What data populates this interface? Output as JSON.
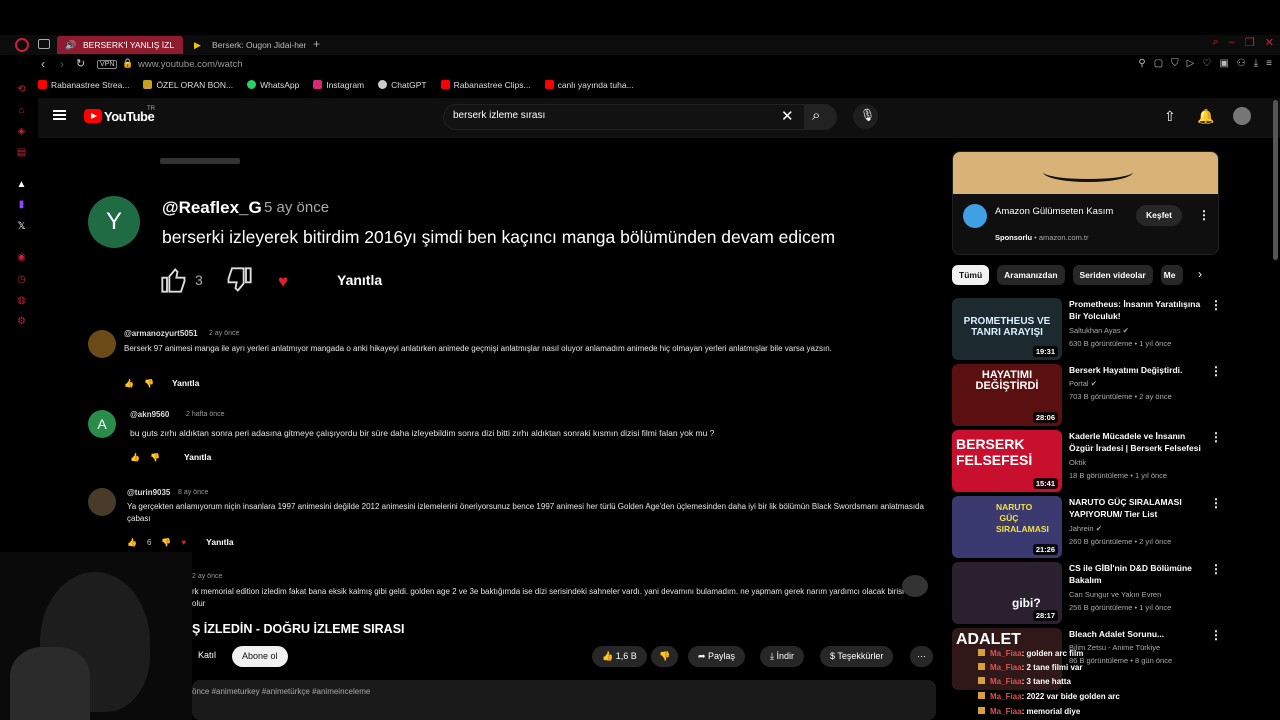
{
  "browser": {
    "tabs": [
      {
        "label": "BERSERK'İ YANLIŞ İZL",
        "active": true
      },
      {
        "label": "Berserk: Ougon Jidai-hen",
        "active": false
      }
    ],
    "url": "www.youtube.com/watch",
    "vpn": "VPN",
    "bookmarks": [
      {
        "label": "Rabanastree Strea...",
        "color": "#ff0000"
      },
      {
        "label": "ÖZEL ORAN BON...",
        "color": "#c8a020"
      },
      {
        "label": "WhatsApp",
        "color": "#25d366"
      },
      {
        "label": "Instagram",
        "color": "#d62976"
      },
      {
        "label": "ChatGPT",
        "color": "#cccccc"
      },
      {
        "label": "Rabanastree Clips...",
        "color": "#ff0000"
      },
      {
        "label": "canlı yayında tuha...",
        "color": "#ff0000"
      }
    ]
  },
  "youtube": {
    "logo": "YouTube",
    "region": "TR",
    "search_query": "berserk izleme sırası"
  },
  "featured_comment": {
    "avatar_letter": "Y",
    "author": "@Reaflex_G",
    "time": "5 ay önce",
    "text": "berserki izleyerek bitirdim 2016yı şimdi ben kaçıncı manga bölümünden devam edicem",
    "likes": "3",
    "reply": "Yanıtla"
  },
  "comments": [
    {
      "author": "@armanozyurt5051",
      "time": "2 ay önce",
      "text": "Berserk 97 animesi manga ile ayrı yerleri anlatmıyor mangada o anki hikayeyi anlatırken animede geçmişi anlatmışlar nasıl oluyor anlamadım animede hiç olmayan yerleri anlatmışlar bile varsa yazsın.",
      "likes": "",
      "reply": "Yanıtla"
    },
    {
      "author": "@akn9560",
      "time": "2 hafta önce",
      "text": "bu guts zırhı aldıktan sonra peri adasına gitmeye çalışıyordu bir süre daha izleyebildim sonra dizi bitti zırhı aldıktan sonraki kısmın dizisi filmi falan yok mu ?",
      "avatar_letter": "A",
      "likes": "",
      "reply": "Yanıtla"
    },
    {
      "author": "@turin9035",
      "time": "8 ay önce",
      "text": "Ya gerçekten anlamıyorum niçin insanlara 1997 animesini değilde 2012 animesini izlemelerini öneriyorsunuz bence 1997 animesi her türlü Golden Age'den üçlemesinden daha iyi bir lik bölümün Black Swordsmanı anlatmasıda çabası",
      "likes": "6",
      "reply": "Yanıtla"
    },
    {
      "author": "",
      "time": "2 ay önce",
      "text": "rk memorial edition izledim fakat bana eksik kalmış gibi geldi. golden age 2 ve 3e baktığımda ise dizi serisindeki sahneler vardı. yani devamını bulamadım. ne yapmam gerek narım yardımcı olacak birisi olur",
      "likes": "",
      "reply": ""
    }
  ],
  "video": {
    "title": "Ş İZLEDİN - DOĞRU İZLEME SIRASI",
    "join": "Katıl",
    "subscribe": "Abone ol",
    "likes": "1,6 B",
    "share": "Paylaş",
    "download": "İndir",
    "thanks": "Teşekkürler",
    "description": "önce #animeturkey #animetürkçe #animeinceleme"
  },
  "ad": {
    "title": "Amazon Gülümseten Kasım",
    "sponsor_label": "Sponsorlu",
    "domain": "amazon.com.tr",
    "button": "Keşfet"
  },
  "chips": [
    "Tümü",
    "Aramanızdan",
    "Seriden videolar",
    "Me"
  ],
  "recommendations": [
    {
      "title": "Prometheus: İnsanın Yaratılışına Bir Yolculuk!",
      "channel": "Saltukhan Ayas",
      "meta": "630 B görüntüleme • 1 yıl önce",
      "duration": "19:31",
      "thumb_text": "PROMETHEUS VE TANRI ARAYIŞI",
      "thumb_color": "#1c2a30",
      "thumb_fg": "#d9f0ff"
    },
    {
      "title": "Berserk Hayatımı Değiştirdi.",
      "channel": "Portal",
      "meta": "703 B görüntüleme • 2 ay önce",
      "duration": "28:06",
      "thumb_text": "HAYATIMI DEĞİŞTİRDİ",
      "thumb_color": "#5a1010",
      "thumb_fg": "#ffffff"
    },
    {
      "title": "Kaderle Mücadele ve İnsanın Özgür İradesi | Berserk Felsefesi",
      "channel": "Oktik",
      "meta": "18 B görüntüleme • 1 yıl önce",
      "duration": "15:41",
      "thumb_text": "BERSERK FELSEFESİ",
      "thumb_color": "#c8102e",
      "thumb_fg": "#ffffff"
    },
    {
      "title": "NARUTO GÜÇ SIRALAMASI YAPIYORUM/ Tier List",
      "channel": "Jahrein",
      "meta": "260 B görüntüleme • 2 yıl önce",
      "duration": "21:26",
      "thumb_text": "NARUTO GÜÇ SIRALAMASI",
      "thumb_color": "#3a3a70",
      "thumb_fg": "#f5e040"
    },
    {
      "title": "CS ile GİBİ'nin D&D Bölümüne Bakalım",
      "channel": "Can Sungur ve Yakın Evren",
      "meta": "256 B görüntüleme • 1 yıl önce",
      "duration": "28:17",
      "thumb_text": "gibi?",
      "thumb_color": "#2a2030",
      "thumb_fg": "#ffffff"
    },
    {
      "title": "Bleach Adalet Sorunu...",
      "channel": "Bilim Zetsu - Anime Türkiye",
      "meta": "86 B görüntüleme • 8 gün önce",
      "duration": "",
      "thumb_text": "ADALET",
      "thumb_color": "#301818",
      "thumb_fg": "#ffffff"
    }
  ],
  "chat": [
    {
      "user": "Ma_Fiaa",
      "msg": ": golden arc film"
    },
    {
      "user": "Ma_Fiaa",
      "msg": ": 2 tane filmi var"
    },
    {
      "user": "Ma_Fiaa",
      "msg": ": 3 tane hatta"
    },
    {
      "user": "Ma_Fiaa",
      "msg": ": 2022 var bide golden arc"
    },
    {
      "user": "Ma_Fiaa",
      "msg": ": memorial diye"
    }
  ]
}
